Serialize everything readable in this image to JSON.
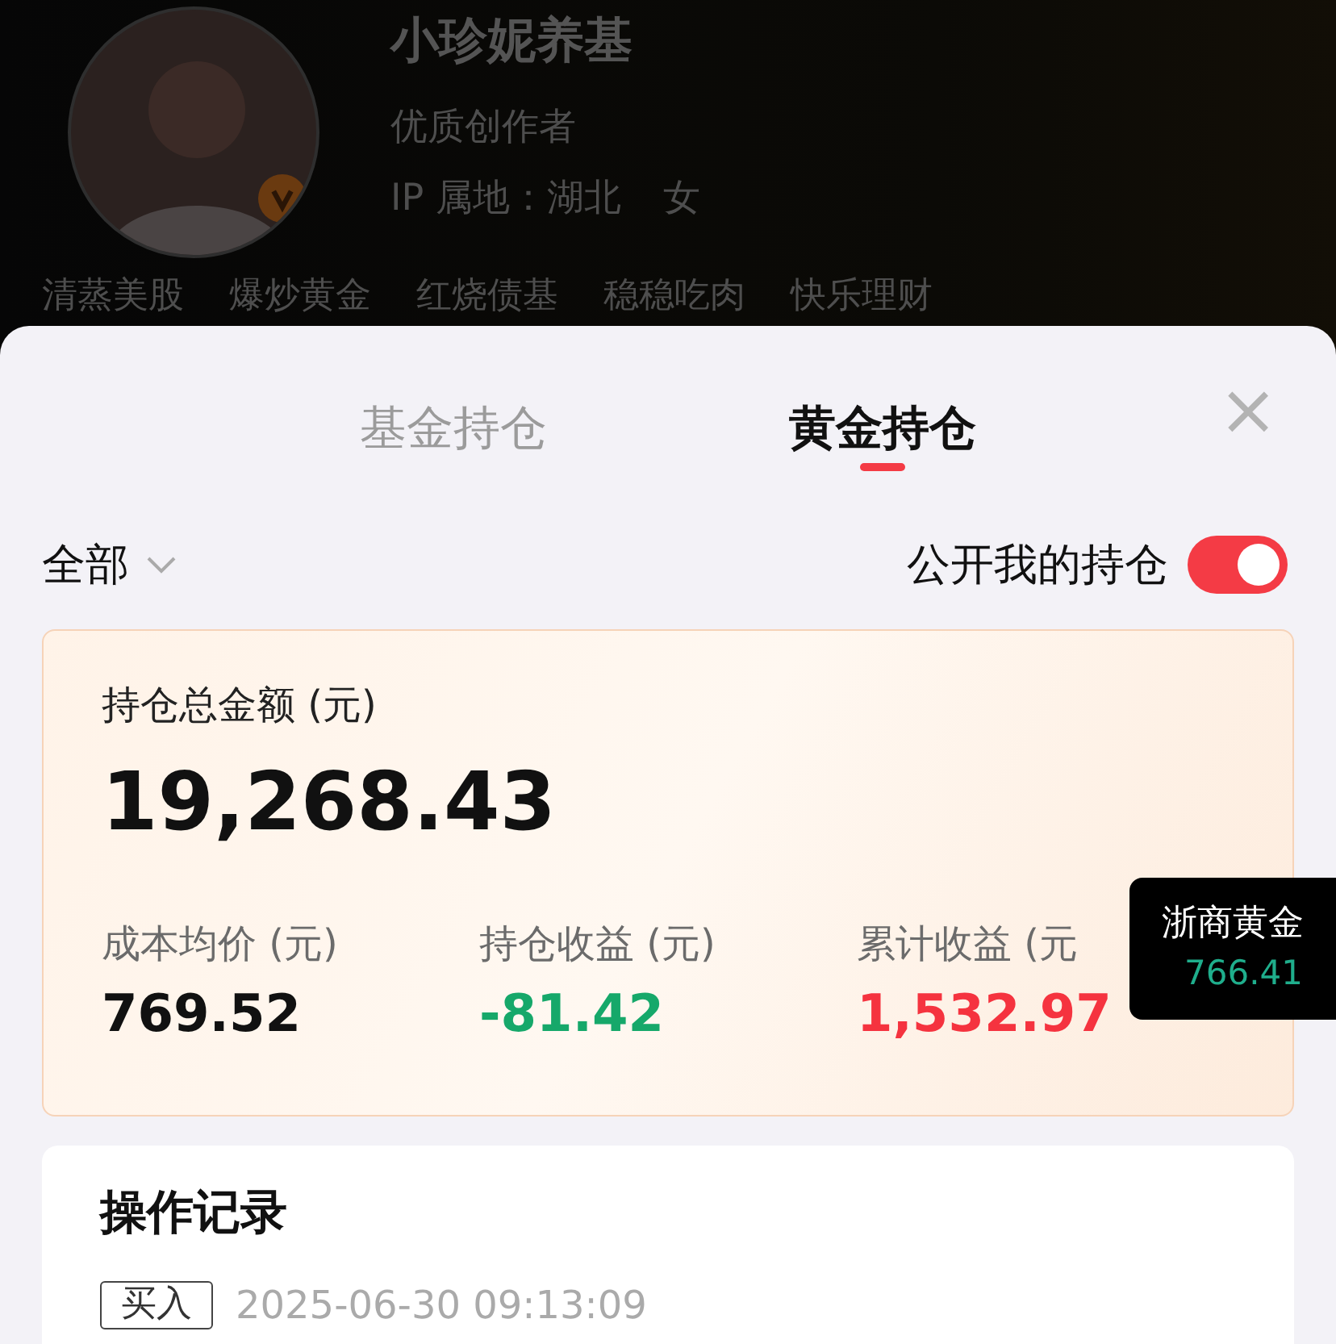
{
  "profile": {
    "name": "小珍妮养基",
    "subtitle": "优质创作者",
    "ip_location": "IP 属地：湖北",
    "gender": "女",
    "verified": true,
    "tags": [
      "清蒸美股",
      "爆炒黄金",
      "红烧债基",
      "稳稳吃肉",
      "快乐理财"
    ]
  },
  "sheet": {
    "tabs": [
      {
        "label": "基金持仓",
        "selected": false
      },
      {
        "label": "黄金持仓",
        "selected": true
      }
    ],
    "close": "×",
    "filter": {
      "label": "全部"
    },
    "public_toggle": {
      "label": "公开我的持仓",
      "on": true
    },
    "summary": {
      "total_label": "持仓总金额 (元)",
      "total_value": "19,268.43",
      "stats": [
        {
          "label": "成本均价 (元)",
          "value": "769.52",
          "kind": "neutral"
        },
        {
          "label": "持仓收益 (元)",
          "value": "-81.42",
          "kind": "loss"
        },
        {
          "label": "累计收益 (元",
          "value": "1,532.97",
          "kind": "gain"
        }
      ]
    },
    "records": {
      "title": "操作记录",
      "items": [
        {
          "type": "买入",
          "time": "2025-06-30 09:13:09"
        }
      ]
    }
  },
  "tooltip": {
    "name": "浙商黄金",
    "value": "766.41"
  }
}
